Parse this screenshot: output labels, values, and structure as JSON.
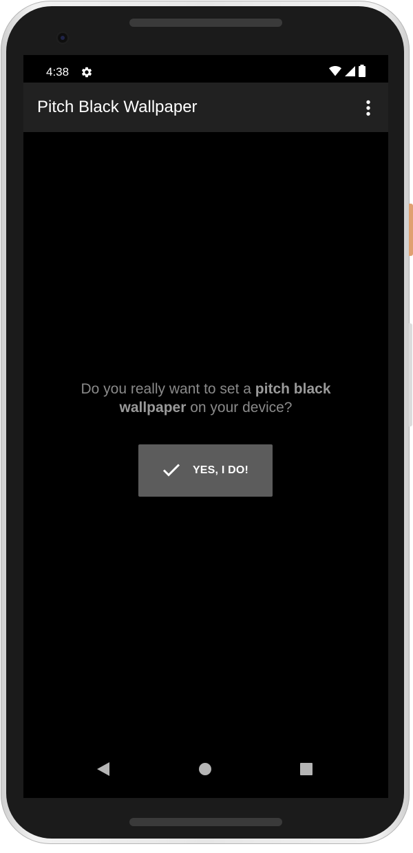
{
  "status_bar": {
    "time": "4:38",
    "icons": [
      "settings-gear-icon",
      "wifi-icon",
      "cellular-signal-icon",
      "battery-icon"
    ]
  },
  "app_bar": {
    "title": "Pitch Black Wallpaper",
    "menu_icon": "more-vert-icon"
  },
  "content": {
    "prompt_part1": "Do you really want to set a ",
    "prompt_bold": "pitch black wallpaper",
    "prompt_part2": " on your device?",
    "confirm_label": "YES, I DO!",
    "confirm_icon": "check-icon"
  },
  "nav_bar": {
    "buttons": [
      "back-icon",
      "home-icon",
      "recents-icon"
    ]
  },
  "colors": {
    "screen_background": "#000000",
    "app_bar": "#212121",
    "prompt_text": "#8a8a8a",
    "button_background": "#5c5c5c",
    "button_text": "#ffffff"
  }
}
